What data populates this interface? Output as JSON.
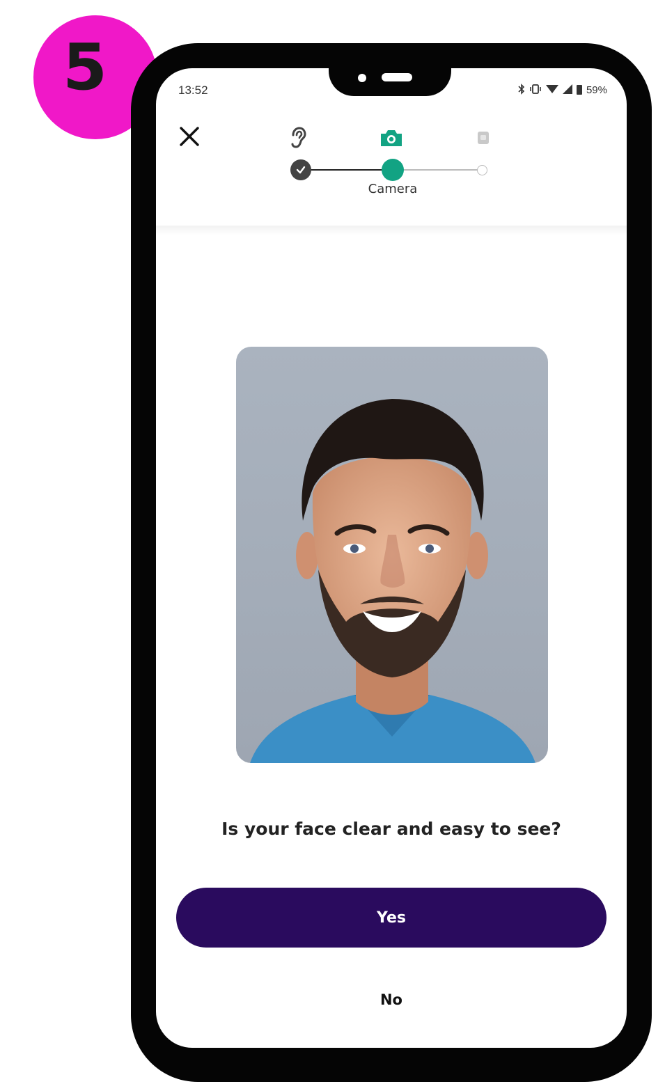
{
  "step_badge": {
    "number": "5",
    "color": "#f018c8"
  },
  "status_bar": {
    "time": "13:52",
    "battery": "59%",
    "icons": [
      "bluetooth-icon",
      "vibrate-icon",
      "wifi-icon",
      "signal-icon",
      "battery-icon"
    ]
  },
  "header": {
    "close_icon": "close-icon",
    "steps": [
      {
        "icon": "ear-icon",
        "state": "completed"
      },
      {
        "icon": "camera-icon",
        "state": "active",
        "label": "Camera"
      },
      {
        "icon": "document-icon",
        "state": "pending"
      }
    ],
    "active_color": "#12a383"
  },
  "main": {
    "photo": "face-photo",
    "question": "Is your face clear and easy to see?"
  },
  "actions": {
    "yes_label": "Yes",
    "no_label": "No",
    "primary_color": "#2a0b5e"
  }
}
